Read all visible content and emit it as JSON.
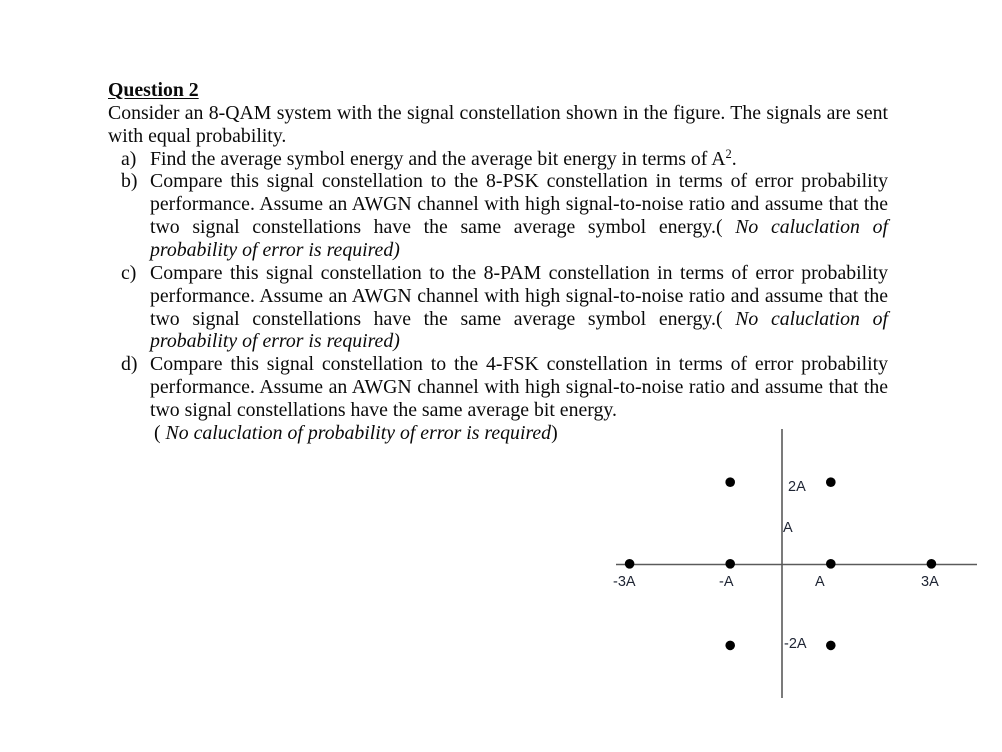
{
  "question": {
    "title": "Question 2",
    "intro": [
      "Consider an 8-QAM system with the signal constellation shown in the figure. The signals are sent",
      "with equal probability."
    ],
    "parts": [
      {
        "label": "a)",
        "lines": [
          {
            "text": "Find the average symbol energy and the average bit energy in terms of A",
            "sup": "2",
            "after": "."
          }
        ]
      },
      {
        "label": "b)",
        "lines": [
          {
            "text": "Compare this signal constellation to the 8-PSK constellation in terms of error probability"
          },
          {
            "text": "performance. Assume an AWGN channel with high signal-to-noise ratio and assume that the"
          },
          {
            "text": "two signal constellations have the same average symbol energy.(",
            "italic": " No caluclation of"
          },
          {
            "italic": "probability of error is required)"
          }
        ]
      },
      {
        "label": "c)",
        "lines": [
          {
            "text": "Compare this signal constellation to the 8-PAM constellation in terms of error probability"
          },
          {
            "text": "performance. Assume an AWGN channel with high signal-to-noise ratio and assume that the"
          },
          {
            "text": "two signal constellations have the same average symbol energy.(",
            "italic": " No caluclation of"
          },
          {
            "italic": "probability of error is required)"
          }
        ]
      },
      {
        "label": "d)",
        "lines": [
          {
            "text": "Compare this signal constellation to the 4-FSK constellation in terms of error probability"
          },
          {
            "text": "performance. Assume an AWGN channel with high signal-to-noise ratio and assume that the"
          },
          {
            "text": "two signal constellations have the same average bit energy."
          },
          {
            "text": "( ",
            "italic": "No caluclation of probability of error is required",
            "after": ")"
          }
        ]
      }
    ]
  },
  "figure": {
    "type": "scatter",
    "description": "8-QAM signal constellation",
    "unit": "A",
    "points": [
      {
        "x": -3,
        "y": 0
      },
      {
        "x": -1,
        "y": 0
      },
      {
        "x": 1,
        "y": 0
      },
      {
        "x": 3,
        "y": 0
      },
      {
        "x": -1,
        "y": 2
      },
      {
        "x": 1,
        "y": 2
      },
      {
        "x": -1,
        "y": -2
      },
      {
        "x": 1,
        "y": -2
      }
    ],
    "x_tick_labels": [
      "-3A",
      "-A",
      "A",
      "3A"
    ],
    "y_labels": [
      "2A",
      "A",
      "-2A"
    ],
    "colors": {
      "points": "#000000",
      "axes": "#5a5a5a",
      "labels": "#1e2433"
    }
  }
}
